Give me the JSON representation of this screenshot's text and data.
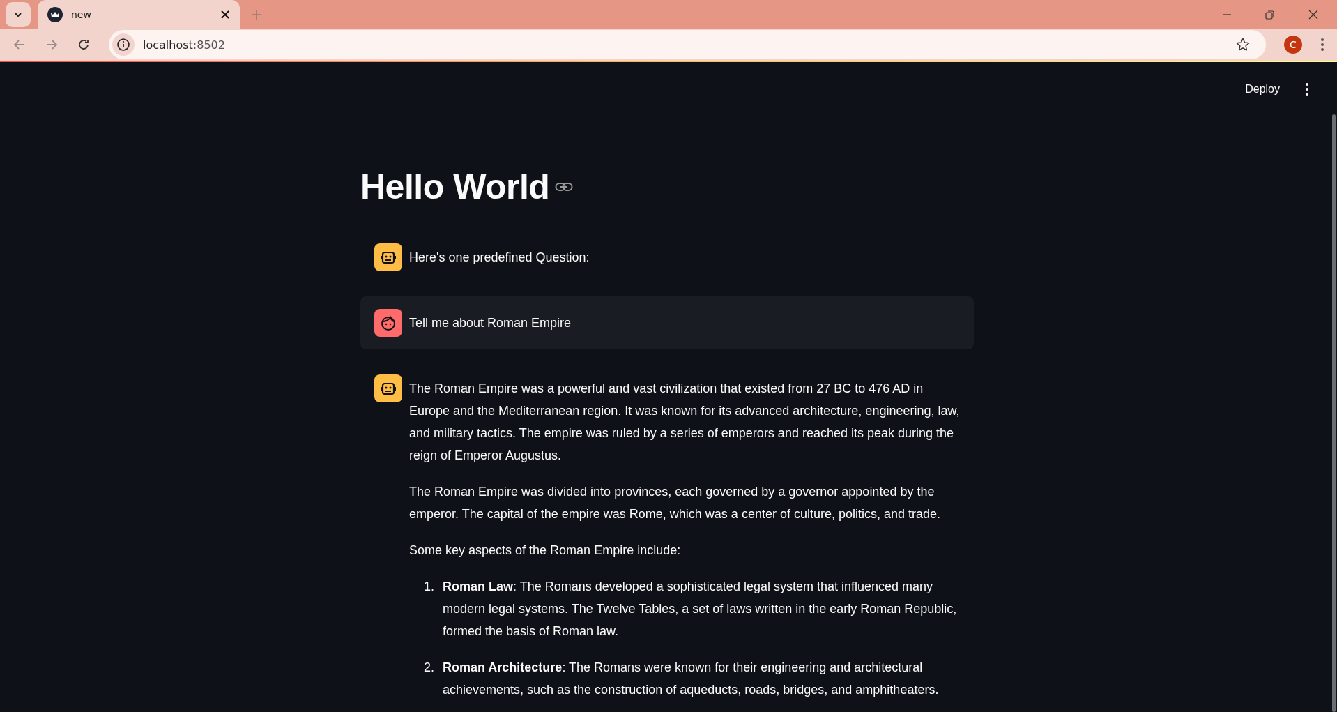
{
  "browser": {
    "tabs": [
      {
        "title": "new",
        "selected": true
      }
    ],
    "address": {
      "host": "localhost",
      "port": ":8502"
    },
    "profile_initial": "C"
  },
  "app_header": {
    "deploy": "Deploy"
  },
  "title": "Hello World",
  "messages": [
    {
      "kind": "assistant",
      "blocks": [
        {
          "kind": "paragraph",
          "text": "Here's one predefined Question:"
        }
      ]
    },
    {
      "kind": "user",
      "blocks": [
        {
          "kind": "paragraph",
          "text": "Tell me about Roman Empire"
        }
      ]
    },
    {
      "kind": "assistant",
      "blocks": [
        {
          "kind": "paragraph",
          "text": "The Roman Empire was a powerful and vast civilization that existed from 27 BC to 476 AD in Europe and the Mediterranean region. It was known for its advanced architecture, engineering, law, and military tactics. The empire was ruled by a series of emperors and reached its peak during the reign of Emperor Augustus."
        },
        {
          "kind": "paragraph",
          "text": "The Roman Empire was divided into provinces, each governed by a governor appointed by the emperor. The capital of the empire was Rome, which was a center of culture, politics, and trade."
        },
        {
          "kind": "paragraph",
          "text": "Some key aspects of the Roman Empire include:"
        },
        {
          "kind": "list",
          "items": [
            {
              "number": "1.",
              "text": "**Roman Law**: The Romans developed a sophisticated legal system that influenced many modern legal systems. The Twelve Tables, a set of laws written in the early Roman Republic, formed the basis of Roman law."
            },
            {
              "number": "2.",
              "text": "**Roman Architecture**: The Romans were known for their engineering and architectural achievements, such as the construction of aqueducts, roads, bridges, and amphitheaters."
            }
          ]
        }
      ]
    }
  ]
}
